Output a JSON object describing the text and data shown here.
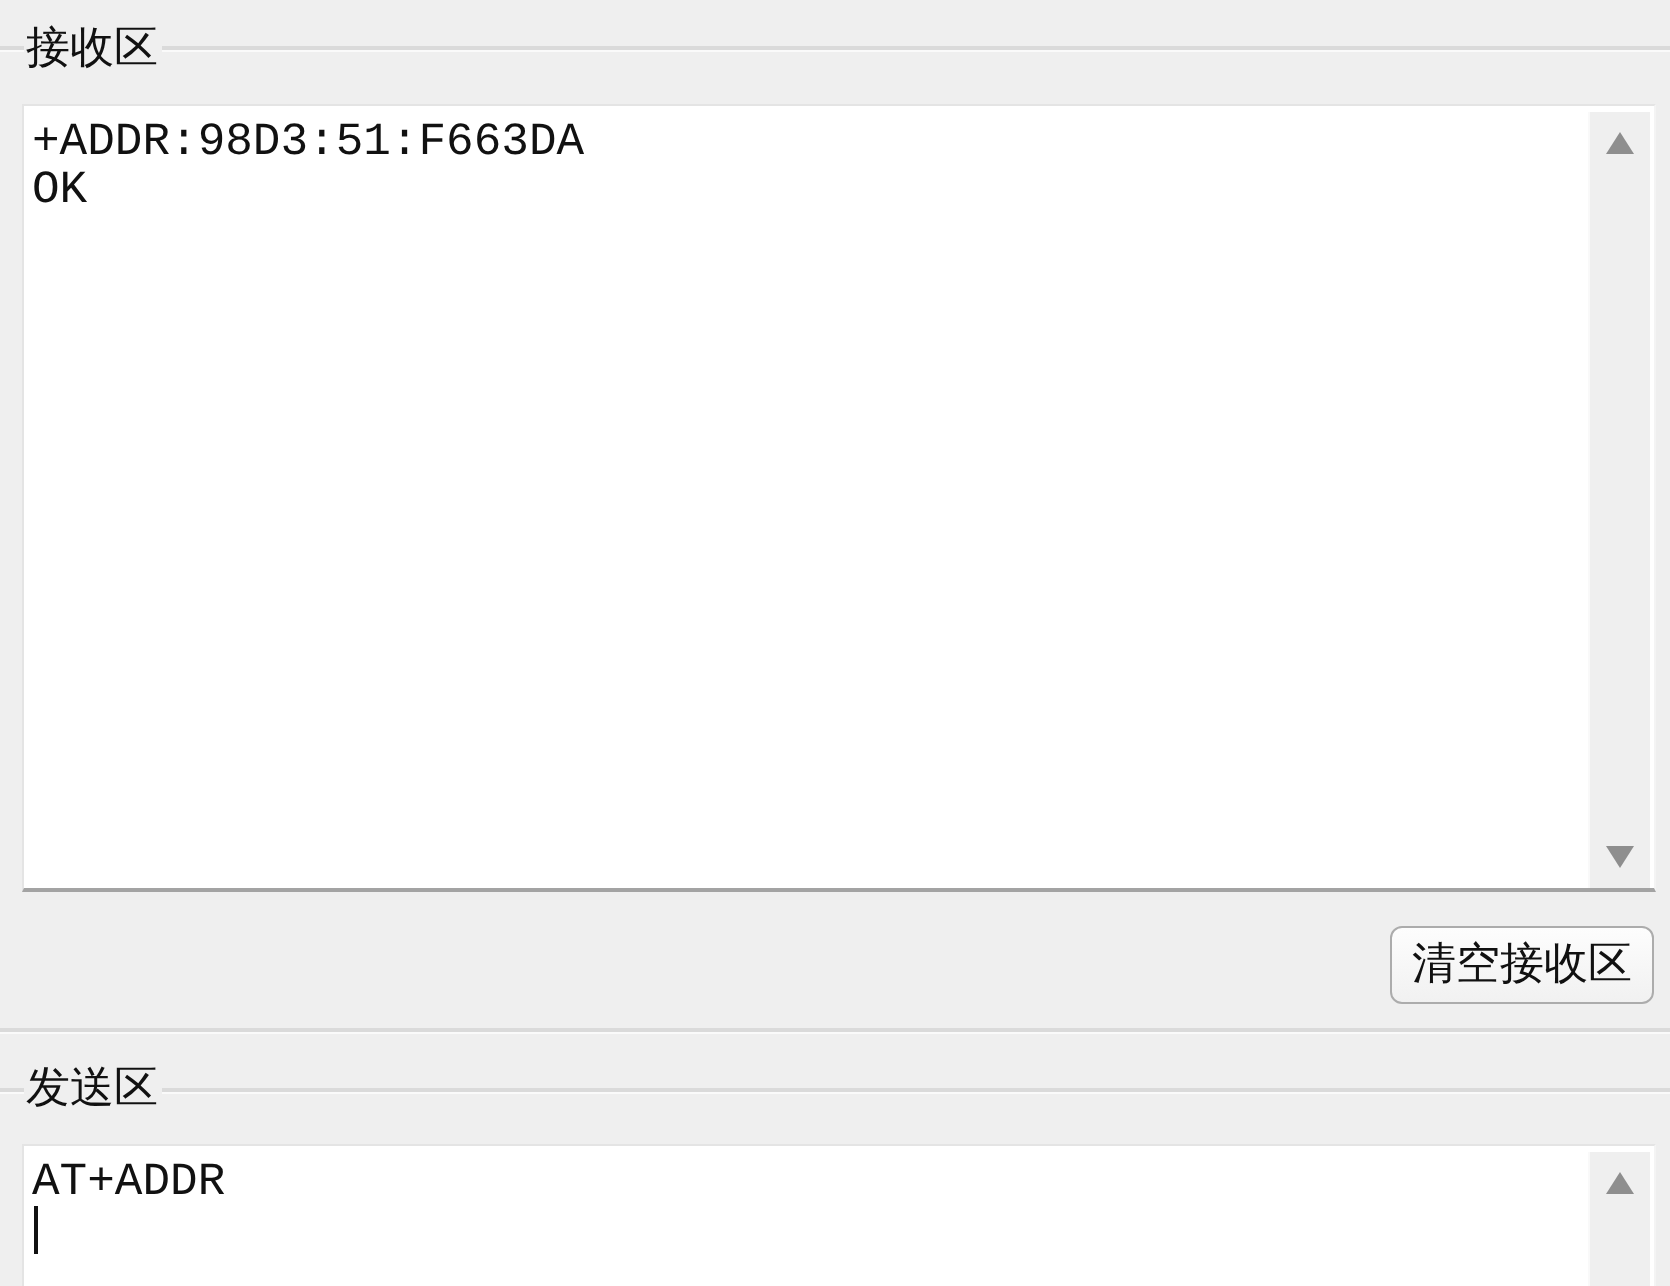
{
  "receive_area": {
    "title": "接收区",
    "lines": [
      "+ADDR:98D3:51:F663DA",
      "OK"
    ]
  },
  "clear_button": {
    "label": "清空接收区"
  },
  "send_area": {
    "title": "发送区",
    "value": "AT+ADDR",
    "focused": true
  }
}
